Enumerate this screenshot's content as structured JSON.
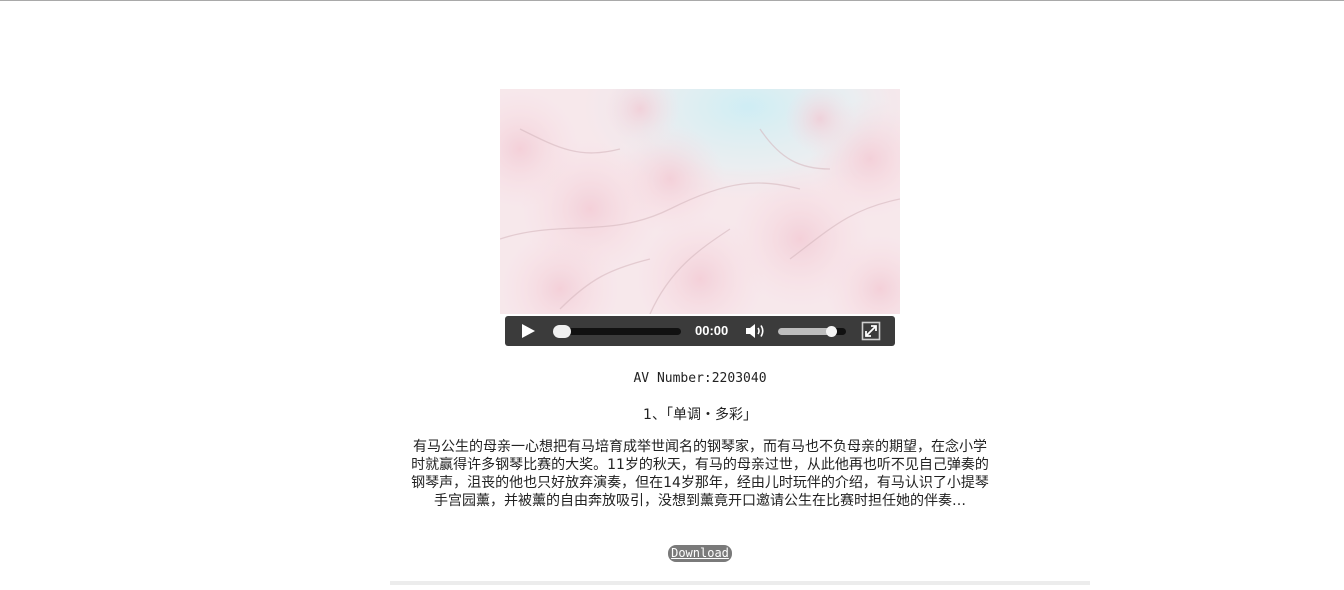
{
  "player": {
    "time": "00:00",
    "progress_fraction": 0,
    "volume_fraction": 0.8
  },
  "video": {
    "av_number": "AV Number:2203040",
    "episode_title": "1、「单调・多彩」",
    "description": "有马公生的母亲一心想把有马培育成举世闻名的钢琴家，而有马也不负母亲的期望，在念小学时就赢得许多钢琴比赛的大奖。11岁的秋天，有马的母亲过世，从此他再也听不见自己弹奏的钢琴声，沮丧的他也只好放弃演奏，但在14岁那年，经由儿时玩伴的介绍，有马认识了小提琴手宫园薰，并被薰的自由奔放吸引，没想到薰竟开口邀请公生在比赛时担任她的伴奏…",
    "download_label": "Download"
  },
  "colors": {
    "control_bar": "#3b3b3b",
    "download_button": "#7a7a7a",
    "sky_blue": "#bfe7f0",
    "blossom_pink": "#f2c9d3"
  },
  "icons": {
    "play": "play-icon",
    "volume": "volume-icon",
    "fullscreen": "fullscreen-icon"
  }
}
